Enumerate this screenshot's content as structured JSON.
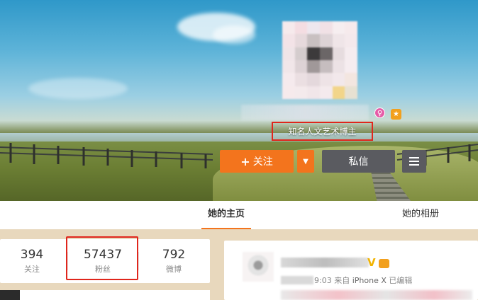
{
  "profile": {
    "verification_label": "知名人文艺术博主",
    "badge_icons": [
      "vip-pink-icon",
      "level-gold-icon"
    ]
  },
  "actions": {
    "follow_label": "关注",
    "follow_icon": "+",
    "more_icon": "▼",
    "message_label": "私信",
    "menu_icon": "hamburger-icon"
  },
  "tabs": {
    "home": "她的主页",
    "photos": "她的相册"
  },
  "stats": [
    {
      "value": "394",
      "label": "关注"
    },
    {
      "value": "57437",
      "label": "粉丝"
    },
    {
      "value": "792",
      "label": "微博"
    }
  ],
  "feed": {
    "verified_mark": "V",
    "time_partial": "9:03",
    "source_prefix": "来自",
    "device": "iPhone X",
    "edited": "已编辑"
  },
  "colors": {
    "accent_orange": "#f3741d",
    "button_gray": "#5a5b60",
    "highlight_red": "#e0261c"
  }
}
